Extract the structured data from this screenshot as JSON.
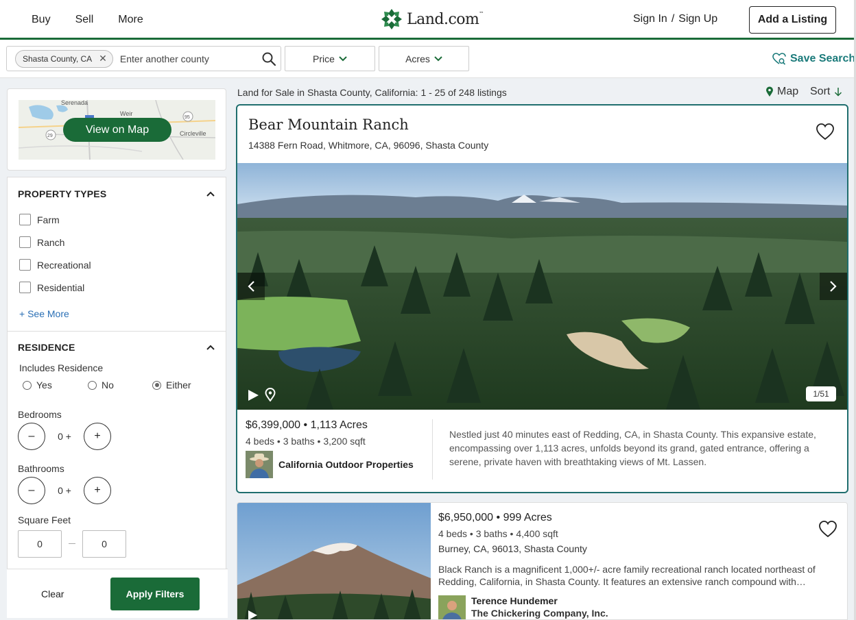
{
  "header": {
    "nav": [
      "Buy",
      "Sell",
      "More"
    ],
    "logo_text": "Land.com",
    "logo_tm": "™",
    "sign_in": "Sign In",
    "sign_sep": "/",
    "sign_up": "Sign Up",
    "add_listing": "Add a Listing",
    "brand_color": "#1a6b38"
  },
  "search": {
    "chip": "Shasta County, CA",
    "placeholder": "Enter another county",
    "price_label": "Price",
    "acres_label": "Acres",
    "save_search": "Save Search"
  },
  "sidebar": {
    "map_labels": [
      "Serenada",
      "Weir",
      "Circleville",
      "95",
      "29"
    ],
    "view_on_map": "View on Map",
    "property_types": {
      "title": "PROPERTY TYPES",
      "items": [
        "Farm",
        "Ranch",
        "Recreational",
        "Residential"
      ],
      "see_more": "+ See More"
    },
    "residence": {
      "title": "RESIDENCE",
      "includes_label": "Includes Residence",
      "options": [
        "Yes",
        "No",
        "Either"
      ],
      "selected": "Either",
      "bedrooms_label": "Bedrooms",
      "bedrooms_value": "0 +",
      "bathrooms_label": "Bathrooms",
      "bathrooms_value": "0 +",
      "sqft_label": "Square Feet",
      "sqft_min": "0",
      "sqft_max": "0",
      "minus": "–",
      "plus": "+"
    },
    "clear": "Clear",
    "apply": "Apply Filters"
  },
  "results": {
    "heading": "Land for Sale in Shasta County, California: 1 - 25 of 248 listings",
    "map_label": "Map",
    "sort_label": "Sort",
    "listings": [
      {
        "title": "Bear Mountain Ranch",
        "address": "14388 Fern Road, Whitmore, CA, 96096, Shasta County",
        "price": "$6,399,000",
        "acres": "1,113 Acres",
        "specs": "4 beds • 3 baths • 3,200 sqft",
        "agent": "California Outdoor Properties",
        "photo_count": "1/51",
        "description": "Nestled just 40 minutes east of Redding, CA, in Shasta County. This expansive estate, encompassing over 1,113 acres, unfolds beyond its grand, gated entrance, offering a serene, private haven with breathtaking views of Mt. Lassen."
      },
      {
        "price": "$6,950,000",
        "acres": "999 Acres",
        "specs": "4 beds • 3 baths • 4,400 sqft",
        "address": "Burney, CA, 96013, Shasta County",
        "description": "Black Ranch is a magnificent 1,000+/- acre family recreational ranch located northeast of Redding, California, in Shasta County. It features an extensive ranch compound with…",
        "agent_name": "Terence Hundemer",
        "agent_company": "The Chickering Company, Inc."
      }
    ]
  }
}
